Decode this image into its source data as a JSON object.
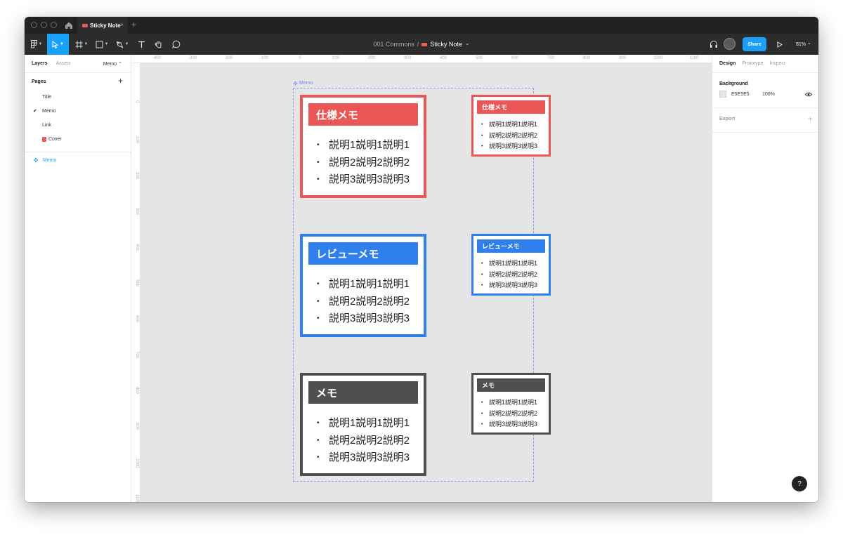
{
  "tab": {
    "title": "Sticky Note",
    "close": "×",
    "new": "+"
  },
  "toolbar": {
    "breadcrumb_project": "001 Commons",
    "breadcrumb_separator": "/",
    "file_name": "Sticky Note",
    "file_caret": "⌄",
    "share_label": "Share",
    "zoom": "81%",
    "zoom_caret": "⌄",
    "play_icon": "▷"
  },
  "left_panel": {
    "tabs": [
      "Layers",
      "Assets"
    ],
    "page_selector": "Memo ⌃",
    "pages_title": "Pages",
    "add_page": "+",
    "pages": [
      {
        "name": "Title",
        "selected": false
      },
      {
        "name": "Memo",
        "selected": true
      },
      {
        "name": "Link",
        "selected": false
      },
      {
        "name": "Cover",
        "selected": false
      }
    ],
    "check": "✔",
    "layer": "Memo"
  },
  "rulers": {
    "top": [
      "-400",
      "-300",
      "-200",
      "-100",
      "0",
      "100",
      "200",
      "300",
      "400",
      "500",
      "600",
      "700",
      "800",
      "900",
      "1000",
      "1100"
    ],
    "left": [
      "0",
      "100",
      "200",
      "300",
      "400",
      "500",
      "600",
      "700",
      "800",
      "900",
      "1000",
      "1100"
    ]
  },
  "canvas": {
    "frame_label": "Memo",
    "notes": [
      {
        "title": "仕様メモ",
        "color": "#EB5757",
        "items": [
          "説明1説明1説明1",
          "説明2説明2説明2",
          "説明3説明3説明3"
        ]
      },
      {
        "title": "レビューメモ",
        "color": "#2F80ED",
        "items": [
          "説明1説明1説明1",
          "説明2説明2説明2",
          "説明3説明3説明3"
        ]
      },
      {
        "title": "メモ",
        "color": "#4F4F4F",
        "items": [
          "説明1説明1説明1",
          "説明2説明2説明2",
          "説明3説明3説明3"
        ]
      }
    ]
  },
  "right_panel": {
    "tabs": [
      "Design",
      "Prototype",
      "Inspect"
    ],
    "background_title": "Background",
    "background_hex": "E5E5E5",
    "background_opacity": "100%",
    "export_label": "Export",
    "export_add": "+"
  },
  "help": "?"
}
